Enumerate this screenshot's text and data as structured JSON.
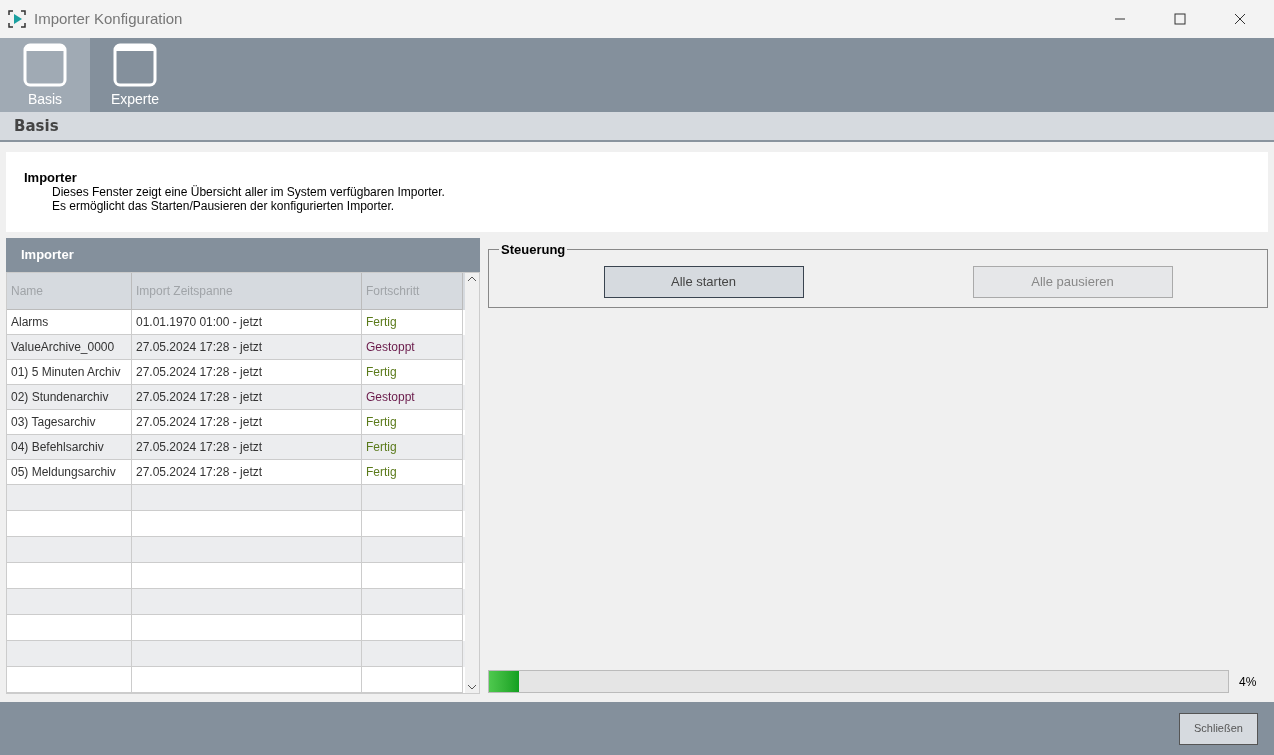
{
  "window": {
    "title": "Importer Konfiguration"
  },
  "tabs": [
    {
      "label": "Basis",
      "selected": true
    },
    {
      "label": "Experte",
      "selected": false
    }
  ],
  "section_title": "Basis",
  "info": {
    "title": "Importer",
    "lines": [
      "Dieses Fenster zeigt eine Übersicht aller im System verfügbaren Importer.",
      "Es ermöglicht das Starten/Pausieren der konfigurierten Importer."
    ]
  },
  "table": {
    "title": "Importer",
    "columns": [
      "Name",
      "Import Zeitspanne",
      "Fortschritt"
    ],
    "rows": [
      {
        "name": "Alarms",
        "span": "01.01.1970 01:00 - jetzt",
        "status": "Fertig",
        "kind": "done"
      },
      {
        "name": "ValueArchive_0000",
        "span": "27.05.2024 17:28 - jetzt",
        "status": "Gestoppt",
        "kind": "stopped"
      },
      {
        "name": "01) 5 Minuten Archiv",
        "span": "27.05.2024 17:28 - jetzt",
        "status": "Fertig",
        "kind": "done"
      },
      {
        "name": "02) Stundenarchiv",
        "span": "27.05.2024 17:28 - jetzt",
        "status": "Gestoppt",
        "kind": "stopped"
      },
      {
        "name": "03) Tagesarchiv",
        "span": "27.05.2024 17:28 - jetzt",
        "status": "Fertig",
        "kind": "done"
      },
      {
        "name": "04) Befehlsarchiv",
        "span": "27.05.2024 17:28 - jetzt",
        "status": "Fertig",
        "kind": "done"
      },
      {
        "name": "05) Meldungsarchiv",
        "span": "27.05.2024 17:28 - jetzt",
        "status": "Fertig",
        "kind": "done"
      }
    ]
  },
  "control": {
    "title": "Steuerung",
    "buttons": [
      {
        "label": "Alle starten",
        "disabled": false
      },
      {
        "label": "Alle pausieren",
        "disabled": true
      }
    ]
  },
  "progress": {
    "level": 0.04,
    "reading": "4%"
  },
  "footer": {
    "close": "Schließen"
  }
}
